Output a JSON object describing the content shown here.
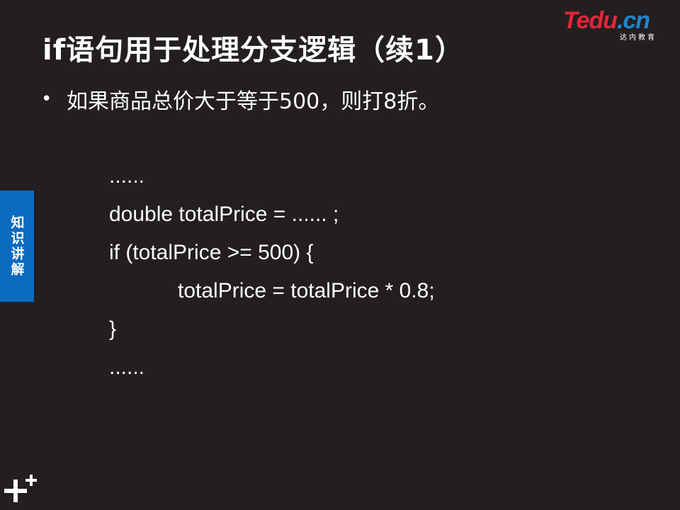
{
  "slide": {
    "title": "if语句用于处理分支逻辑（续1）",
    "bullet_text": "如果商品总价大于等于500，则打8折。",
    "code_lines": [
      "......",
      "double totalPrice = ...... ;",
      "if (totalPrice >= 500) {",
      "totalPrice = totalPrice * 0.8;",
      "}",
      "......"
    ]
  },
  "side_tab": {
    "label": "知识讲解",
    "color": "#0b6bc1"
  },
  "logo": {
    "main_red": "Tedu",
    "main_blue": ".cn",
    "sub": "达内教育"
  },
  "theme": {
    "background": "#231f20",
    "text": "#ffffff"
  },
  "icons": {
    "bottom_left": "plus-icon"
  }
}
